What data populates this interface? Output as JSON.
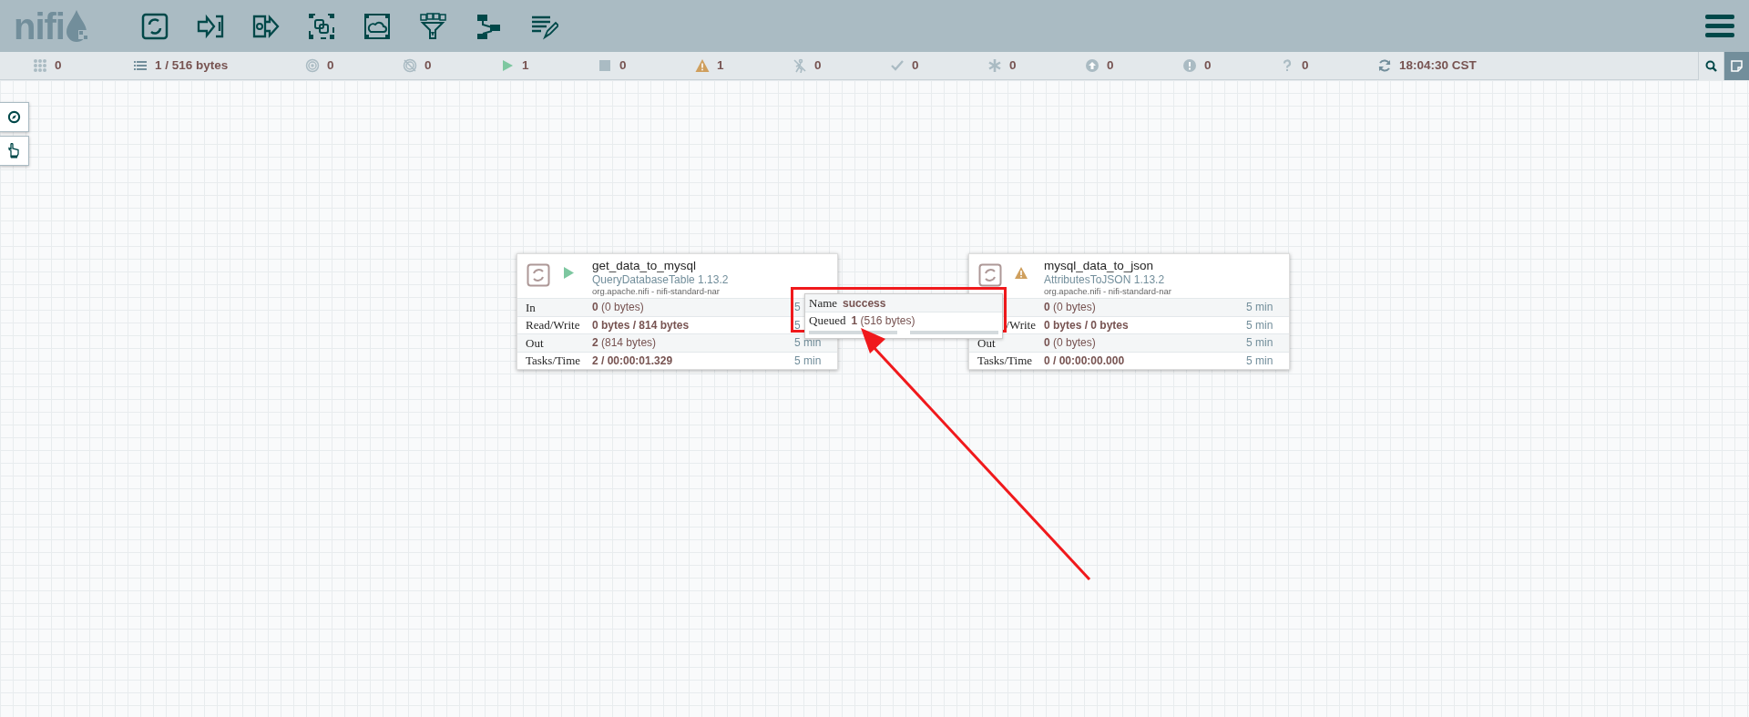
{
  "logo": "nifi",
  "status_bar": [
    {
      "kind": "active-threads",
      "value": "0"
    },
    {
      "kind": "queued",
      "value": "1 / 516 bytes"
    },
    {
      "kind": "transmitting",
      "value": "0"
    },
    {
      "kind": "not-transmitting",
      "value": "0"
    },
    {
      "kind": "running",
      "value": "1"
    },
    {
      "kind": "stopped",
      "value": "0"
    },
    {
      "kind": "invalid",
      "value": "1"
    },
    {
      "kind": "disabled",
      "value": "0"
    },
    {
      "kind": "up-to-date",
      "value": "0"
    },
    {
      "kind": "modified",
      "value": "0"
    },
    {
      "kind": "stale",
      "value": "0"
    },
    {
      "kind": "sync-failure",
      "value": "0"
    },
    {
      "kind": "unknown",
      "value": "0"
    },
    {
      "kind": "refresh",
      "value": "18:04:30 CST"
    }
  ],
  "processors": [
    {
      "name": "get_data_to_mysql",
      "type": "QueryDatabaseTable 1.13.2",
      "bundle": "org.apache.nifi - nifi-standard-nar",
      "running": true,
      "valid": true,
      "stats": [
        {
          "label": "In",
          "value": "0",
          "detail": "(0 bytes)",
          "time": "5"
        },
        {
          "label": "Read/Write",
          "value": "0 bytes / 814 bytes",
          "time": "5"
        },
        {
          "label": "Out",
          "value": "2",
          "detail": "(814 bytes)",
          "time": "5 min"
        },
        {
          "label": "Tasks/Time",
          "value": "2 / 00:00:01.329",
          "time": "5 min"
        }
      ]
    },
    {
      "name": "mysql_data_to_json",
      "type": "AttributesToJSON 1.13.2",
      "bundle": "org.apache.nifi - nifi-standard-nar",
      "valid": false,
      "stats": [
        {
          "value": "0",
          "detail": "(0 bytes)",
          "time": "5 min"
        },
        {
          "label": "/Write",
          "label_cut": true,
          "value": "0 bytes / 0 bytes",
          "time": "5 min"
        },
        {
          "label": "Out",
          "value": "0",
          "detail": "(0 bytes)",
          "time": "5 min"
        },
        {
          "label": "Tasks/Time",
          "value": "0 / 00:00:00.000",
          "time": "5 min"
        }
      ]
    }
  ],
  "connection": {
    "name_label": "Name",
    "name": "success",
    "queued_label": "Queued",
    "queued_count": "1",
    "queued_detail": "(516 bytes)"
  }
}
